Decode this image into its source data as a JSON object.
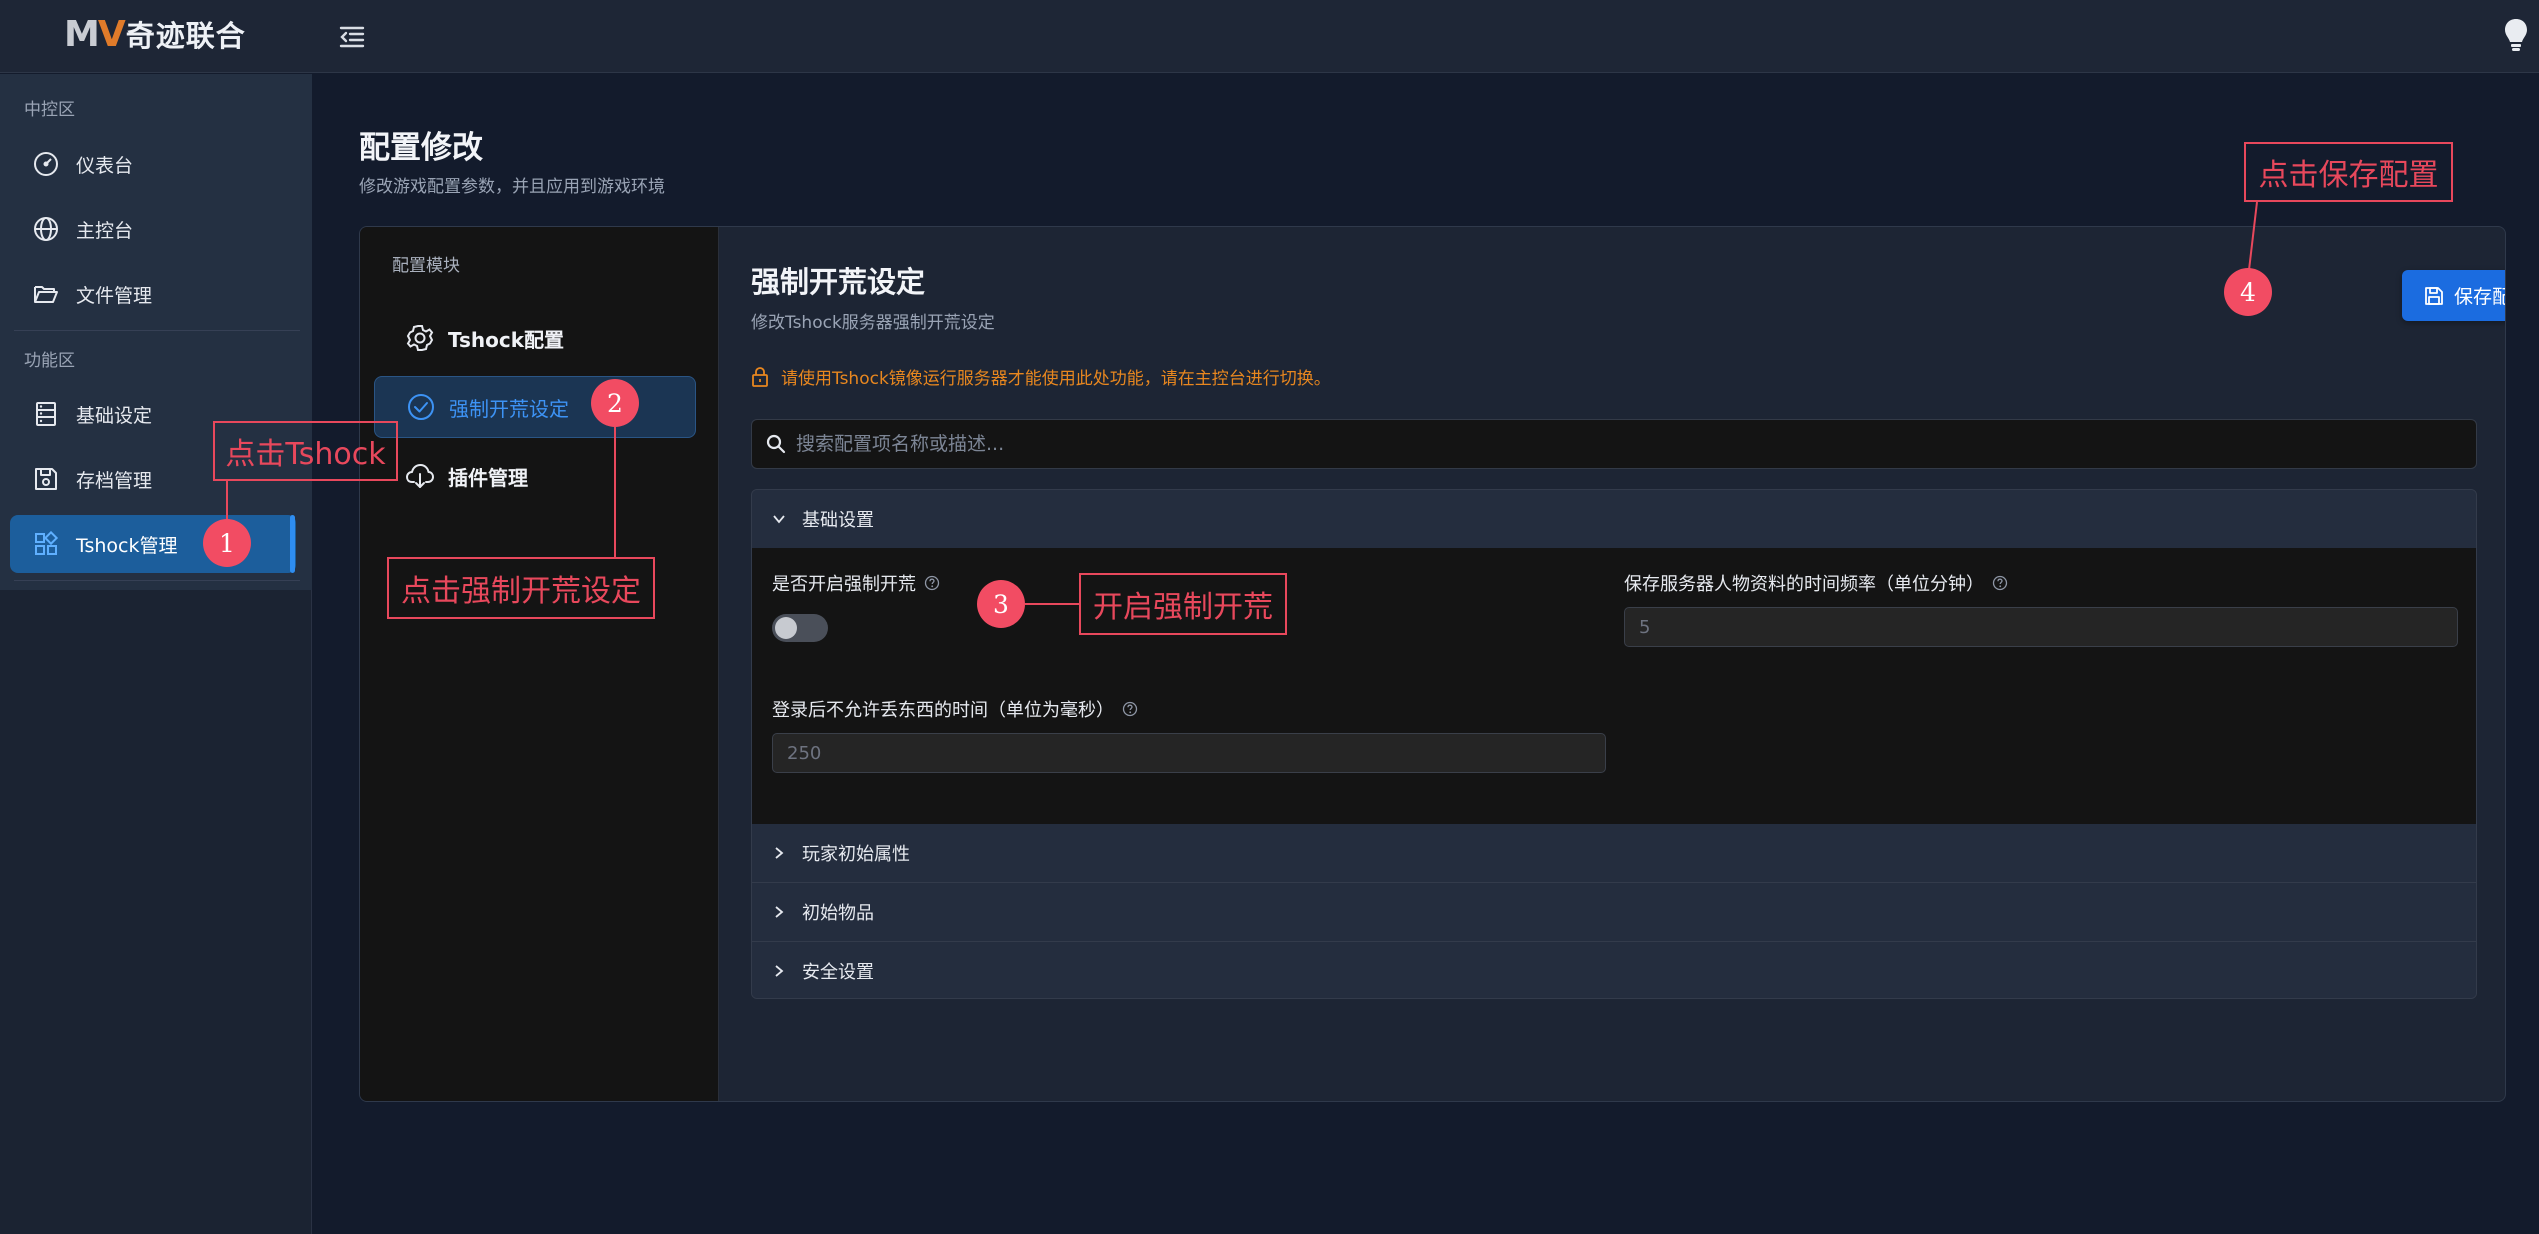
{
  "header": {
    "logo_mark": "MV",
    "logo_text": "奇迹联合",
    "menu_icon": "menu-fold-icon",
    "theme_icon": "lightbulb-icon"
  },
  "sidebar": {
    "sections": [
      {
        "label": "中控区"
      },
      {
        "label": "功能区"
      }
    ],
    "items": [
      {
        "label": "仪表台",
        "icon": "dashboard-icon"
      },
      {
        "label": "主控台",
        "icon": "globe-icon"
      },
      {
        "label": "文件管理",
        "icon": "folder-open-icon"
      },
      {
        "label": "基础设定",
        "icon": "server-icon"
      },
      {
        "label": "存档管理",
        "icon": "save-icon"
      },
      {
        "label": "Tshock管理",
        "icon": "apps-icon",
        "active": true
      }
    ]
  },
  "page": {
    "title": "配置修改",
    "subtitle": "修改游戏配置参数，并且应用到游戏环境"
  },
  "modules": {
    "title": "配置模块",
    "items": [
      {
        "label": "Tshock配置",
        "icon": "gear-icon"
      },
      {
        "label": "强制开荒设定",
        "icon": "check-circle-icon",
        "active": true
      },
      {
        "label": "插件管理",
        "icon": "cloud-download-icon"
      }
    ]
  },
  "content": {
    "title": "强制开荒设定",
    "subtitle": "修改Tshock服务器强制开荒设定",
    "save_label": "保存配置",
    "warning": "请使用Tshock镜像运行服务器才能使用此处功能，请在主控台进行切换。",
    "search_placeholder": "搜索配置项名称或描述..."
  },
  "accordion": {
    "sections": [
      {
        "label": "基础设置",
        "expanded": true
      },
      {
        "label": "玩家初始属性",
        "expanded": false
      },
      {
        "label": "初始物品",
        "expanded": false
      },
      {
        "label": "安全设置",
        "expanded": false
      }
    ],
    "fields": {
      "force_pioneer": {
        "label": "是否开启强制开荒",
        "enabled": false
      },
      "save_interval": {
        "label": "保存服务器人物资料的时间频率（单位分钟）",
        "placeholder": "5"
      },
      "no_drop_time": {
        "label": "登录后不允许丢东西的时间（单位为毫秒）",
        "placeholder": "250"
      }
    }
  },
  "annotations": [
    {
      "number": "1",
      "text": "点击Tshock"
    },
    {
      "number": "2",
      "text": "点击强制开荒设定"
    },
    {
      "number": "3",
      "text": "开启强制开荒"
    },
    {
      "number": "4",
      "text": "点击保存配置"
    }
  ],
  "colors": {
    "accent": "#1b6ce0",
    "active_nav": "#1c5e9c",
    "warning": "#e8871f",
    "annotation": "#e8485c"
  }
}
